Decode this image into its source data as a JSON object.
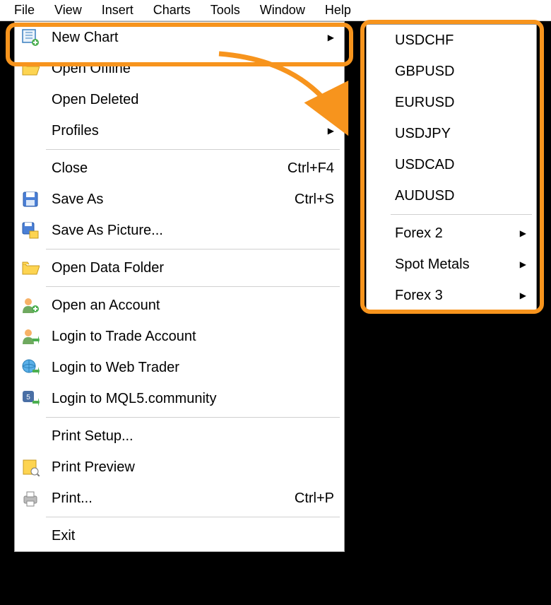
{
  "menubar": [
    "File",
    "View",
    "Insert",
    "Charts",
    "Tools",
    "Window",
    "Help"
  ],
  "fileMenu": {
    "newChart": "New Chart",
    "openOffline": "Open Offline",
    "openDeleted": "Open Deleted",
    "profiles": "Profiles",
    "close": "Close",
    "closeShortcut": "Ctrl+F4",
    "saveAs": "Save As",
    "saveAsShortcut": "Ctrl+S",
    "saveAsPicture": "Save As Picture...",
    "openDataFolder": "Open Data Folder",
    "openAccount": "Open an Account",
    "loginTrade": "Login to Trade Account",
    "loginWeb": "Login to Web Trader",
    "loginMQL5": "Login to MQL5.community",
    "printSetup": "Print Setup...",
    "printPreview": "Print Preview",
    "print": "Print...",
    "printShortcut": "Ctrl+P",
    "exit": "Exit"
  },
  "submenu": {
    "usdchf": "USDCHF",
    "gbpusd": "GBPUSD",
    "eurusd": "EURUSD",
    "usdjpy": "USDJPY",
    "usdcad": "USDCAD",
    "audusd": "AUDUSD",
    "forex2": "Forex 2",
    "spotMetals": "Spot Metals",
    "forex3": "Forex 3"
  }
}
